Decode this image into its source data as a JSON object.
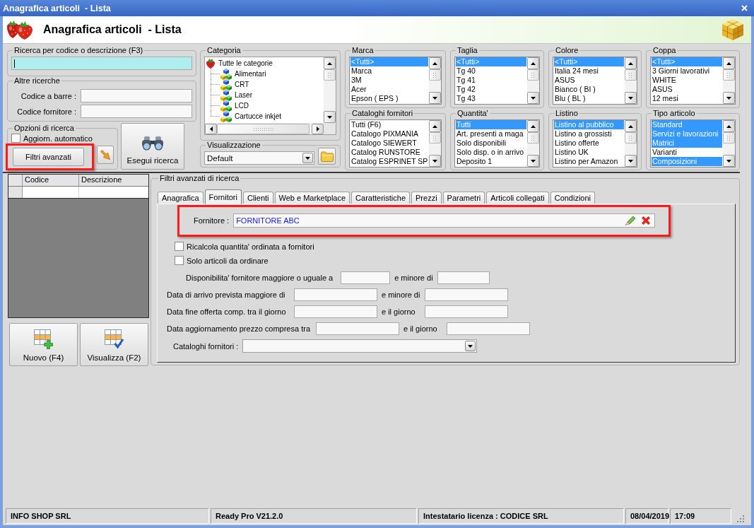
{
  "window": {
    "title": "Anagrafica articoli  - Lista"
  },
  "header": {
    "title": "Anagrafica articoli  - Lista"
  },
  "code_search": {
    "title": "Ricerca per codice o descrizione (F3)",
    "focused": true
  },
  "other_searches": {
    "title": "Altre ricerche",
    "fields": [
      {
        "label": "Codice a barre :"
      },
      {
        "label": "Codice fornitore :"
      }
    ]
  },
  "search_options": {
    "title": "Opzioni di ricerca",
    "auto_update": {
      "label": "Aggiorn. automatico",
      "checked": false
    },
    "advanced_button": "Filtri avanzati"
  },
  "run_search_button": "Esegui ricerca",
  "category": {
    "title": "Categoria",
    "tree": [
      {
        "label": "Tutte le categorie",
        "children": [
          {
            "label": "Alimentari"
          },
          {
            "label": "CRT"
          },
          {
            "label": "Laser"
          },
          {
            "label": "LCD"
          },
          {
            "label": "Cartucce inkjet"
          }
        ]
      }
    ]
  },
  "view": {
    "title": "Visualizzazione",
    "value": "Default"
  },
  "lists": [
    {
      "title": "Marca",
      "items": [
        {
          "label": "<Tutti>",
          "selected": true
        },
        {
          "label": "Marca",
          "selected": false
        },
        {
          "label": "3M",
          "selected": false
        },
        {
          "label": "Acer",
          "selected": false
        },
        {
          "label": "Epson ( EPS )",
          "selected": false
        }
      ]
    },
    {
      "title": "Taglia",
      "items": [
        {
          "label": "<Tutti>",
          "selected": true
        },
        {
          "label": "Tg 40",
          "selected": false
        },
        {
          "label": "Tg 41",
          "selected": false
        },
        {
          "label": "Tg 42",
          "selected": false
        },
        {
          "label": "Tg 43",
          "selected": false
        }
      ]
    },
    {
      "title": "Colore",
      "items": [
        {
          "label": "<Tutti>",
          "selected": true
        },
        {
          "label": "Italia 24 mesi",
          "selected": false
        },
        {
          "label": "ASUS",
          "selected": false
        },
        {
          "label": "Bianco ( BI )",
          "selected": false
        },
        {
          "label": "Blu ( BL )",
          "selected": false
        }
      ]
    },
    {
      "title": "Coppa",
      "items": [
        {
          "label": "<Tutti>",
          "selected": true
        },
        {
          "label": "3 Giorni lavorativi",
          "selected": false
        },
        {
          "label": "WHITE",
          "selected": false
        },
        {
          "label": "ASUS",
          "selected": false
        },
        {
          "label": "12 mesi",
          "selected": false
        }
      ]
    },
    {
      "title": "Cataloghi fornitori",
      "items": [
        {
          "label": "Tutti (F6)",
          "selected": false
        },
        {
          "label": "Catalogo PIXMANIA",
          "selected": false
        },
        {
          "label": "Catalogo SIEWERT",
          "selected": false
        },
        {
          "label": "Catalog RUNSTORE",
          "selected": false
        },
        {
          "label": "Catalog ESPRINET SP",
          "selected": false
        }
      ]
    },
    {
      "title": "Quantita'",
      "items": [
        {
          "label": "Tutti",
          "selected": true
        },
        {
          "label": "Art. presenti a maga",
          "selected": false
        },
        {
          "label": "Solo disponibili",
          "selected": false
        },
        {
          "label": "Solo disp. o in arrivo",
          "selected": false
        },
        {
          "label": "Deposito 1",
          "selected": false
        }
      ]
    },
    {
      "title": "Listino",
      "items": [
        {
          "label": "Listino al pubblico",
          "selected": true
        },
        {
          "label": "Listino a grossisti",
          "selected": false
        },
        {
          "label": "Listino offerte",
          "selected": false
        },
        {
          "label": "Listino UK",
          "selected": false
        },
        {
          "label": "Listino per Amazon",
          "selected": false
        }
      ]
    },
    {
      "title": "Tipo articolo",
      "items": [
        {
          "label": "Standard",
          "selected": true
        },
        {
          "label": "Servizi e lavorazioni",
          "selected": true
        },
        {
          "label": "Matrici",
          "selected": true
        },
        {
          "label": "Varianti",
          "selected": false
        },
        {
          "label": "Composizioni",
          "selected": true
        }
      ]
    }
  ],
  "results_grid": {
    "columns": [
      "Codice",
      "Descrizione"
    ]
  },
  "grid_buttons": [
    {
      "label": "Nuovo (F4)",
      "kind": "new"
    },
    {
      "label": "Visualizza (F2)",
      "kind": "view"
    }
  ],
  "advanced_filters": {
    "title": "Filtri avanzati di ricerca",
    "tabs": [
      {
        "label": "Anagrafica",
        "selected": false
      },
      {
        "label": "Fornitori",
        "selected": true
      },
      {
        "label": "Clienti",
        "selected": false
      },
      {
        "label": "Web e Marketplace",
        "selected": false
      },
      {
        "label": "Caratteristiche",
        "selected": false
      },
      {
        "label": "Prezzi",
        "selected": false
      },
      {
        "label": "Parametri",
        "selected": false
      },
      {
        "label": "Articoli collegati",
        "selected": false
      },
      {
        "label": "Condizioni",
        "selected": false
      }
    ],
    "supplier": {
      "label": "Fornitore :",
      "value": "FORNITORE ABC"
    },
    "checkboxes": [
      {
        "label": "Ricalcola quantita' ordinata a fornitori",
        "checked": false
      },
      {
        "label": "Solo articoli da ordinare",
        "checked": false
      }
    ],
    "ranges": [
      {
        "kind": "number",
        "label": "Disponibilita' fornitore maggiore o uguale a",
        "joiner": "e minore di"
      },
      {
        "kind": "date",
        "label": "Data di arrivo prevista maggiore di",
        "joiner": "e minore di"
      },
      {
        "kind": "date",
        "label": "Data fine offerta comp. tra il giorno",
        "joiner": "e il giorno"
      },
      {
        "kind": "date",
        "label": "Data aggiornamento prezzo compresa tra",
        "joiner": "e il giorno"
      }
    ],
    "catalogs": {
      "label": "Cataloghi fornitori :"
    }
  },
  "status_bar": [
    "INFO SHOP SRL",
    "Ready Pro V21.2.0",
    "Intestatario licenza : CODICE SRL",
    "08/04/2019",
    "17:09"
  ]
}
